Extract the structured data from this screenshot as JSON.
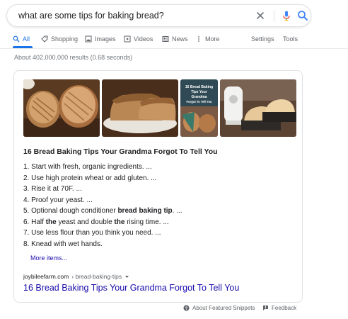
{
  "search": {
    "query": "what are some tips for baking bread?"
  },
  "icons": {
    "clear": "close-icon",
    "mic": "microphone-icon",
    "search": "search-icon"
  },
  "tabs": [
    {
      "label": "All",
      "icon": "search-icon",
      "active": true
    },
    {
      "label": "Shopping",
      "icon": "tag-icon"
    },
    {
      "label": "Images",
      "icon": "image-icon"
    },
    {
      "label": "Videos",
      "icon": "play-icon"
    },
    {
      "label": "News",
      "icon": "newspaper-icon"
    },
    {
      "label": "More",
      "icon": "kebab-icon"
    }
  ],
  "tools": {
    "settings": "Settings",
    "tools": "Tools"
  },
  "result_stats": "About 402,000,000 results (0.68 seconds)",
  "featured_snippet": {
    "images": [
      {
        "name": "bread-loaves-image"
      },
      {
        "name": "bread-loaf-plate-image"
      },
      {
        "name": "bread-tips-pin-image",
        "overlay_text": [
          "16 Bread Baking",
          "Tips Your",
          "Grandma",
          "Forgot To Tell You"
        ]
      },
      {
        "name": "bread-mixer-pans-image"
      }
    ],
    "title": "16 Bread Baking Tips Your Grandma Forgot To Tell You",
    "steps": [
      {
        "num": "1.",
        "parts": [
          {
            "t": "Start with fresh, organic ingredients. ..."
          }
        ]
      },
      {
        "num": "2.",
        "parts": [
          {
            "t": "Use high protein wheat or add gluten. ..."
          }
        ]
      },
      {
        "num": "3.",
        "parts": [
          {
            "t": "Rise it at 70F. ..."
          }
        ]
      },
      {
        "num": "4.",
        "parts": [
          {
            "t": "Proof your yeast. ..."
          }
        ]
      },
      {
        "num": "5.",
        "parts": [
          {
            "t": "Optional dough conditioner "
          },
          {
            "t": "bread baking tip",
            "b": true
          },
          {
            "t": ". ..."
          }
        ]
      },
      {
        "num": "6.",
        "parts": [
          {
            "t": "Half "
          },
          {
            "t": "the",
            "b": true
          },
          {
            "t": " yeast and double "
          },
          {
            "t": "the",
            "b": true
          },
          {
            "t": " rising time. ..."
          }
        ]
      },
      {
        "num": "7.",
        "parts": [
          {
            "t": "Use less flour than you think you need. ..."
          }
        ]
      },
      {
        "num": "8.",
        "parts": [
          {
            "t": "Knead with wet hands."
          }
        ]
      }
    ],
    "more_items": "More items...",
    "cite_host": "joybileefarm.com",
    "cite_path": "› bread-baking-tips",
    "link_title": "16 Bread Baking Tips Your Grandma Forgot To Tell You"
  },
  "footer": {
    "about": "About Featured Snippets",
    "feedback": "Feedback"
  },
  "colors": {
    "link": "#1a0dab",
    "accent": "#1a73e8",
    "muted": "#5f6368"
  }
}
